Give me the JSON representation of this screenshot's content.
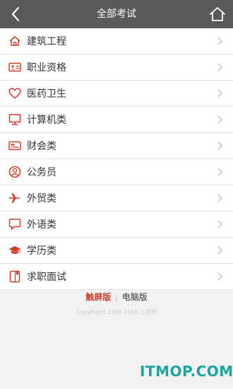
{
  "header": {
    "title": "全部考试"
  },
  "menu": {
    "items": [
      {
        "label": "建筑工程",
        "icon": "home-outline-icon"
      },
      {
        "label": "职业资格",
        "icon": "id-card-icon"
      },
      {
        "label": "医药卫生",
        "icon": "heart-icon"
      },
      {
        "label": "计算机类",
        "icon": "monitor-icon"
      },
      {
        "label": "财会类",
        "icon": "card-icon"
      },
      {
        "label": "公务员",
        "icon": "person-circle-icon"
      },
      {
        "label": "外贸类",
        "icon": "airplane-icon"
      },
      {
        "label": "外语类",
        "icon": "speech-bubble-icon"
      },
      {
        "label": "学历类",
        "icon": "graduation-cap-icon"
      },
      {
        "label": "求职面试",
        "icon": "book-icon"
      }
    ]
  },
  "footer": {
    "touch_label": "触屏版",
    "separator": "|",
    "pc_label": "电脑版",
    "copyright": "CopyRight 2009-2016 上学吧"
  },
  "watermark": {
    "text": "ITMOP.COM"
  },
  "colors": {
    "header_bg": "#595959",
    "accent_red": "#d23a2a",
    "watermark": "#1fa5a0"
  }
}
